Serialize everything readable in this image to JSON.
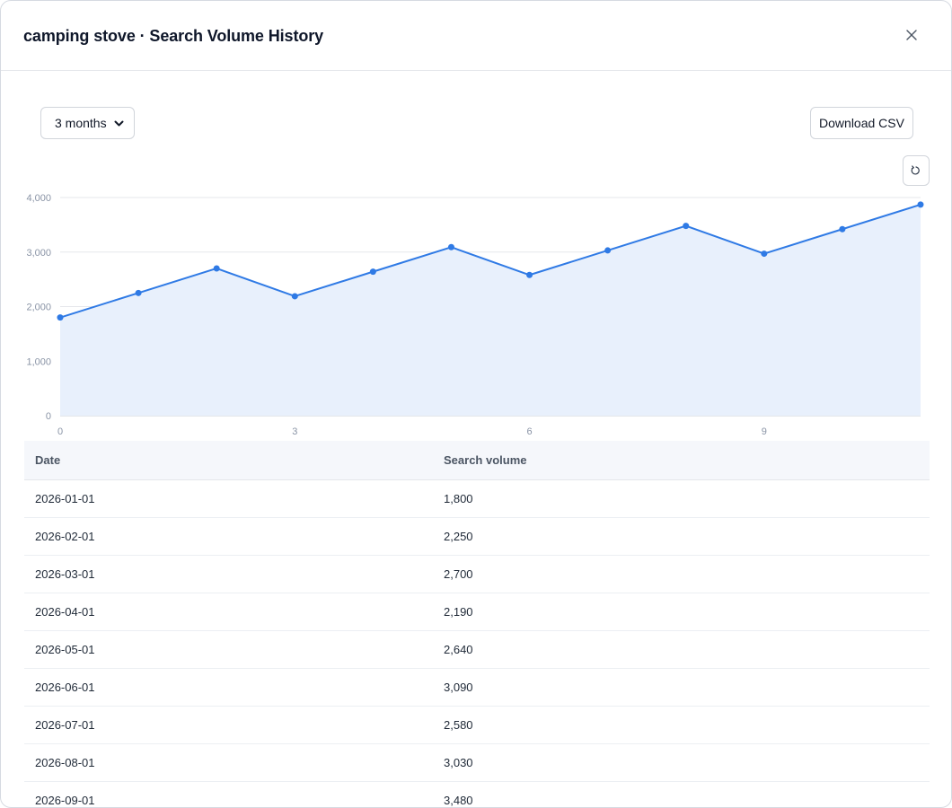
{
  "modal": {
    "title": "camping stove · Search Volume History"
  },
  "controls": {
    "range_select": {
      "selected": "3 months"
    },
    "download_label": "Download CSV"
  },
  "icons": {
    "close": "close-icon",
    "reset": "reset-zoom-icon",
    "chevron": "chevron-down-icon"
  },
  "colors": {
    "line": "#2f7ae5",
    "area": "#e8f0fc",
    "grid": "#e5e7eb"
  },
  "chart_data": {
    "type": "area",
    "x": [
      0,
      1,
      2,
      3,
      4,
      5,
      6,
      7,
      8,
      9,
      10,
      11
    ],
    "y_ticks": [
      "0",
      "1,000",
      "2,000",
      "3,000",
      "4,000"
    ],
    "x_ticks": [
      "0",
      "3",
      "6",
      "9"
    ],
    "series": [
      {
        "values": [
          1800,
          2250,
          2700,
          2190,
          2640,
          3090,
          2580,
          3030,
          3480,
          2970,
          3420,
          3870
        ]
      }
    ],
    "xlim": [
      0,
      11
    ],
    "ylim": [
      0,
      4000
    ],
    "grid": true
  },
  "table": {
    "headers": [
      "Date",
      "Search volume"
    ],
    "rows": [
      [
        "2026-01-01",
        "1,800"
      ],
      [
        "2026-02-01",
        "2,250"
      ],
      [
        "2026-03-01",
        "2,700"
      ],
      [
        "2026-04-01",
        "2,190"
      ],
      [
        "2026-05-01",
        "2,640"
      ],
      [
        "2026-06-01",
        "3,090"
      ],
      [
        "2026-07-01",
        "2,580"
      ],
      [
        "2026-08-01",
        "3,030"
      ],
      [
        "2026-09-01",
        "3,480"
      ]
    ]
  }
}
